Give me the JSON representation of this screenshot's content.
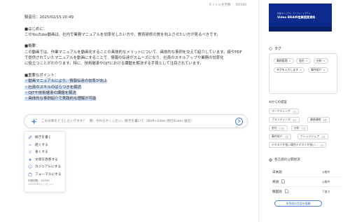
{
  "title_count": "タイトル文字数：　50/100",
  "editor": {
    "registered": "録音日：2025/02/15 20:49",
    "intro_heading": "■はじめに：",
    "intro_text": "このYouTube動画は、社内で業務マニュアルを効率化したい方や、教育研修の質を向上させたい方が見るべきです。",
    "overview_heading": "■概要：",
    "overview_line1": "この動画では、作業マニュアルを動画化することの具体的なメリットについて、具体的な事例を交えて紹介しています。紙やPDF",
    "overview_line2": "で提供されていたマニュアルを動画にすることで、情報の伝達がスムーズになり、社員のスキルアップや業務の効率化",
    "overview_line3": "に役立つことがわかります。特に、技術継承やOJTにおける課題を解決する手段として注目されています。",
    "points_heading": "■重要なポイント：",
    "points": [
      "・動画マニュアルにより、情報伝達の効率が向上",
      "・社員のスキルのばらつきを解消",
      "・OJTや技術継承の課題を解決",
      "・具体的な事例紹介で実践的な理解が可能"
    ]
  },
  "ai_bar": {
    "placeholder": "この文章をどうしたいですか？　例：やわらかくしたい、続きを書いて（Shift+Enter:改行/Enter:送信）"
  },
  "ai_menu": {
    "items": [
      {
        "label": "続きを書く",
        "icon": "pencil-icon"
      },
      {
        "label": "短くする",
        "icon": "shorten-icon"
      },
      {
        "label": "長くする",
        "icon": "lengthen-icon"
      },
      {
        "label": "文章を改善する",
        "icon": "sparkle-icon"
      },
      {
        "label": "カジュアルにする",
        "icon": "smile-icon"
      },
      {
        "label": "フォーマルにする",
        "icon": "briefcase-icon"
      }
    ],
    "usage": "利用回数：10/100",
    "usage_sub": "(2025/04/01にリセット)"
  },
  "sidebar": {
    "thumbnail": {
      "line1": "作業マニュアル・テンプレートモデル",
      "line2": "Video BRAIN営業提案資料",
      "bg_color": "#0b2a8c"
    },
    "tags_title": "タグ",
    "tags": [
      "業務管理",
      "金社",
      "分析",
      "タグを入力します",
      "事件紹介"
    ],
    "ai_tags_title": "AIからの提案",
    "suggestions": [
      {
        "label": "マーケティング",
        "count": "1件"
      },
      {
        "label": "ブランディング",
        "count": "6件"
      },
      {
        "label": "業務連絡",
        "count": "8件"
      },
      {
        "label": "金社",
        "count": "10件"
      },
      {
        "label": "分析",
        "count": "5件"
      },
      {
        "label": "事件紹介",
        "count": "7件"
      },
      {
        "label": "ナレッジシェア",
        "count": "3件"
      },
      {
        "label": "テキストが長い場合テキストが長い...",
        "count": "1件"
      }
    ],
    "publish_title": "各言語の公開状況",
    "languages": [
      {
        "name": "日本語",
        "status": "公開中"
      },
      {
        "name": "英語",
        "status": "公開中"
      },
      {
        "name": "韓国語",
        "status": "下書き"
      }
    ],
    "open_button": "未作成の言語を展開"
  },
  "colors": {
    "accent": "#4a7fd6",
    "highlight": "#cfe0f6",
    "thumbnail_bg": "#0b2a8c"
  }
}
